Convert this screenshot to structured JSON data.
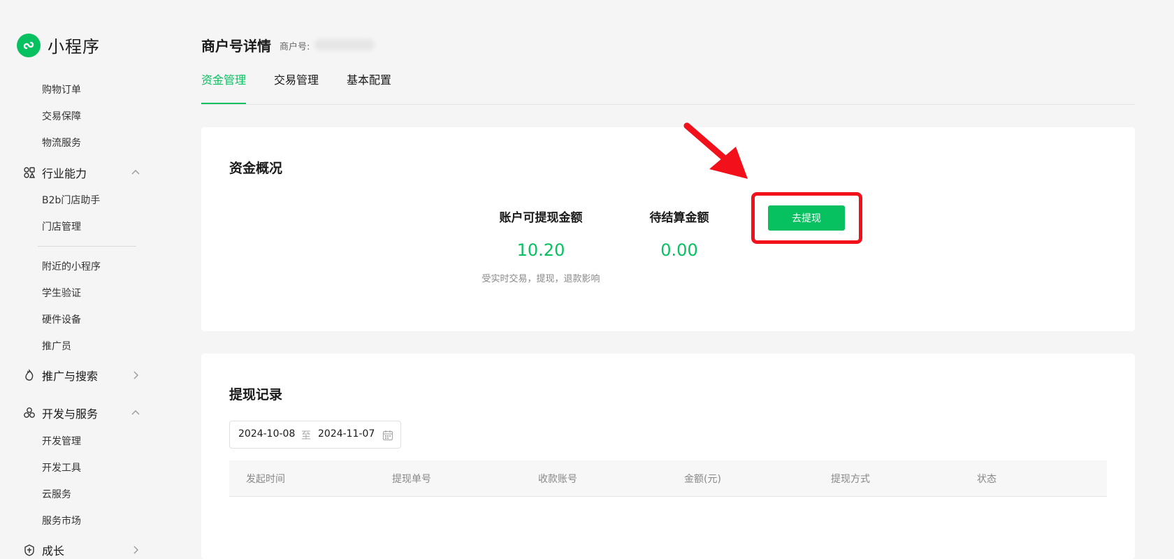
{
  "app": {
    "logo_text": "小程序"
  },
  "sidebar": {
    "items_top": [
      "购物订单",
      "交易保障",
      "物流服务"
    ],
    "group_industry": "行业能力",
    "items_industry": [
      "B2b门店助手",
      "门店管理"
    ],
    "items_misc": [
      "附近的小程序",
      "学生验证",
      "硬件设备",
      "推广员"
    ],
    "group_promo": "推广与搜索",
    "group_dev": "开发与服务",
    "items_dev": [
      "开发管理",
      "开发工具",
      "云服务",
      "服务市场"
    ],
    "group_growth": "成长"
  },
  "header": {
    "title": "商户号详情",
    "merchant_label": "商户号:"
  },
  "tabs": [
    "资金管理",
    "交易管理",
    "基本配置"
  ],
  "overview": {
    "title": "资金概况",
    "available_label": "账户可提现金额",
    "available_value": "10.20",
    "available_note": "受实时交易，提现，退款影响",
    "pending_label": "待结算金额",
    "pending_value": "0.00",
    "withdraw_button": "去提现"
  },
  "records": {
    "title": "提现记录",
    "date_start": "2024-10-08",
    "date_sep": "至",
    "date_end": "2024-11-07",
    "columns": [
      "发起时间",
      "提现单号",
      "收款账号",
      "金额(元)",
      "提现方式",
      "状态"
    ]
  },
  "colors": {
    "accent": "#07c160",
    "highlight": "#f2101a"
  }
}
